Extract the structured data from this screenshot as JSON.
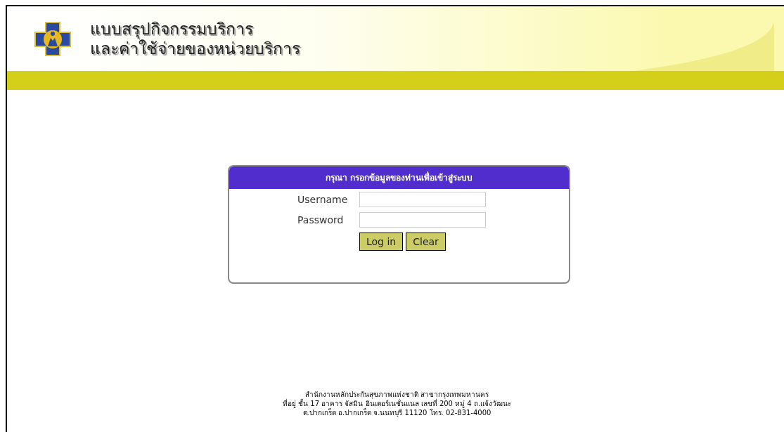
{
  "header": {
    "title_lines": [
      "แบบสรุปกิจกรรมบริการ",
      "และค่าใช้จ่ายของหน่วยบริการ"
    ]
  },
  "login": {
    "heading": "กรุณา กรอกข้อมูลของท่านเพื่อเข้าสู่ระบบ",
    "fields": [
      {
        "label": "Username"
      },
      {
        "label": "Password"
      }
    ],
    "buttons": [
      "Log in",
      "Clear"
    ]
  },
  "footer": [
    "สำนักงานหลักประกันสุขภาพแห่งชาติ สาขากรุงเทพมหานคร",
    "ที่อยู่ ชั้น 17 อาคาร จัสมิน อินเตอร์เนชั่นแนล เลขที่ 200 หมู่ 4 ถ.แจ้งวัฒนะ",
    "ต.ปากเกร็ด อ.ปากเกร็ด จ.นนทบุรี 11120 โทร. 02-831-4000"
  ]
}
